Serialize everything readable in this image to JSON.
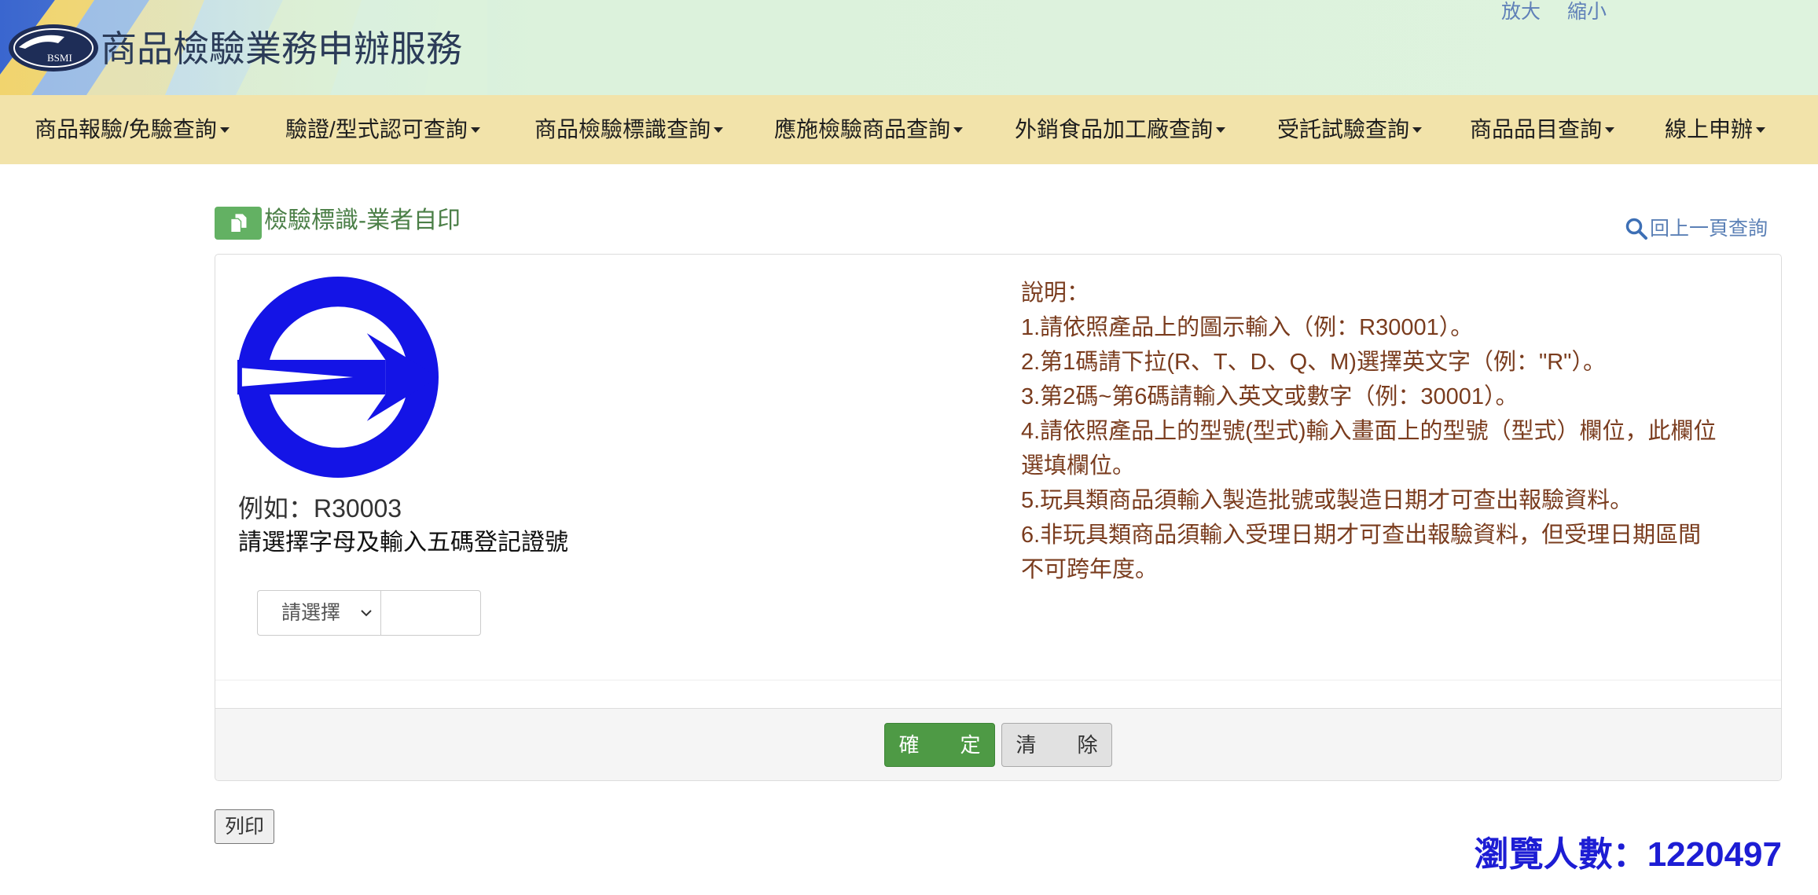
{
  "header": {
    "logo_icon": "bsmi-logo",
    "logo_text": "BSMI",
    "title": "商品檢驗業務申辦服務",
    "zoom_in": "放大",
    "zoom_out": "縮小"
  },
  "nav": {
    "caret_icon": "caret-down-icon",
    "items": [
      {
        "label": "商品報驗/免驗查詢"
      },
      {
        "label": "驗證/型式認可查詢"
      },
      {
        "label": "商品檢驗標識查詢"
      },
      {
        "label": "應施檢驗商品查詢"
      },
      {
        "label": "外銷食品加工廠查詢"
      },
      {
        "label": "受託試驗查詢"
      },
      {
        "label": "商品品目查詢"
      },
      {
        "label": "線上申辦"
      }
    ]
  },
  "page": {
    "title_icon": "copy-document-icon",
    "title": "檢驗標識-業者自印",
    "back_icon": "search-icon",
    "back_link": "回上一頁查詢"
  },
  "form": {
    "mark_icon": "commodity-inspection-mark-icon",
    "example": "例如：R30003",
    "instruction": "請選擇字母及輸入五碼登記證號",
    "letter_select": {
      "selected": "請選擇",
      "icon": "chevron-down-icon"
    },
    "serial_input": {
      "value": ""
    }
  },
  "notes": {
    "heading": "說明：",
    "items": [
      {
        "lines": [
          "1.請依照產品上的圖示輸入（例：R30001）。"
        ]
      },
      {
        "lines": [
          "2.第1碼請下拉(R、T、D、Q、M)選擇英文字（例：\"R\"）。"
        ]
      },
      {
        "lines": [
          "3.第2碼~第6碼請輸入英文或數字（例：30001）。"
        ]
      },
      {
        "lines": [
          "4.請依照產品上的型號(型式)輸入畫面上的型號（型式）欄位，此欄位",
          "選填欄位。"
        ]
      },
      {
        "lines": [
          "5.玩具類商品須輸入製造批號或製造日期才可查出報驗資料。"
        ]
      },
      {
        "lines": [
          "6.非玩具類商品須輸入受理日期才可查出報驗資料，但受理日期區間",
          "不可跨年度。"
        ]
      }
    ]
  },
  "actions": {
    "confirm": "確　　定",
    "clear": "清　　除",
    "print": "列印"
  },
  "footer": {
    "visitor_label": "瀏覽人數：",
    "visitor_count": "1220497"
  },
  "colors": {
    "header_bg": "#dcf2dc",
    "nav_bg": "#f2e3aa",
    "title_green": "#4b7f47",
    "notes_brown": "#7a3c1e",
    "confirm_green": "#4e9a45",
    "visitor_blue": "#1d1dd4",
    "mark_blue": "#1414e6"
  }
}
